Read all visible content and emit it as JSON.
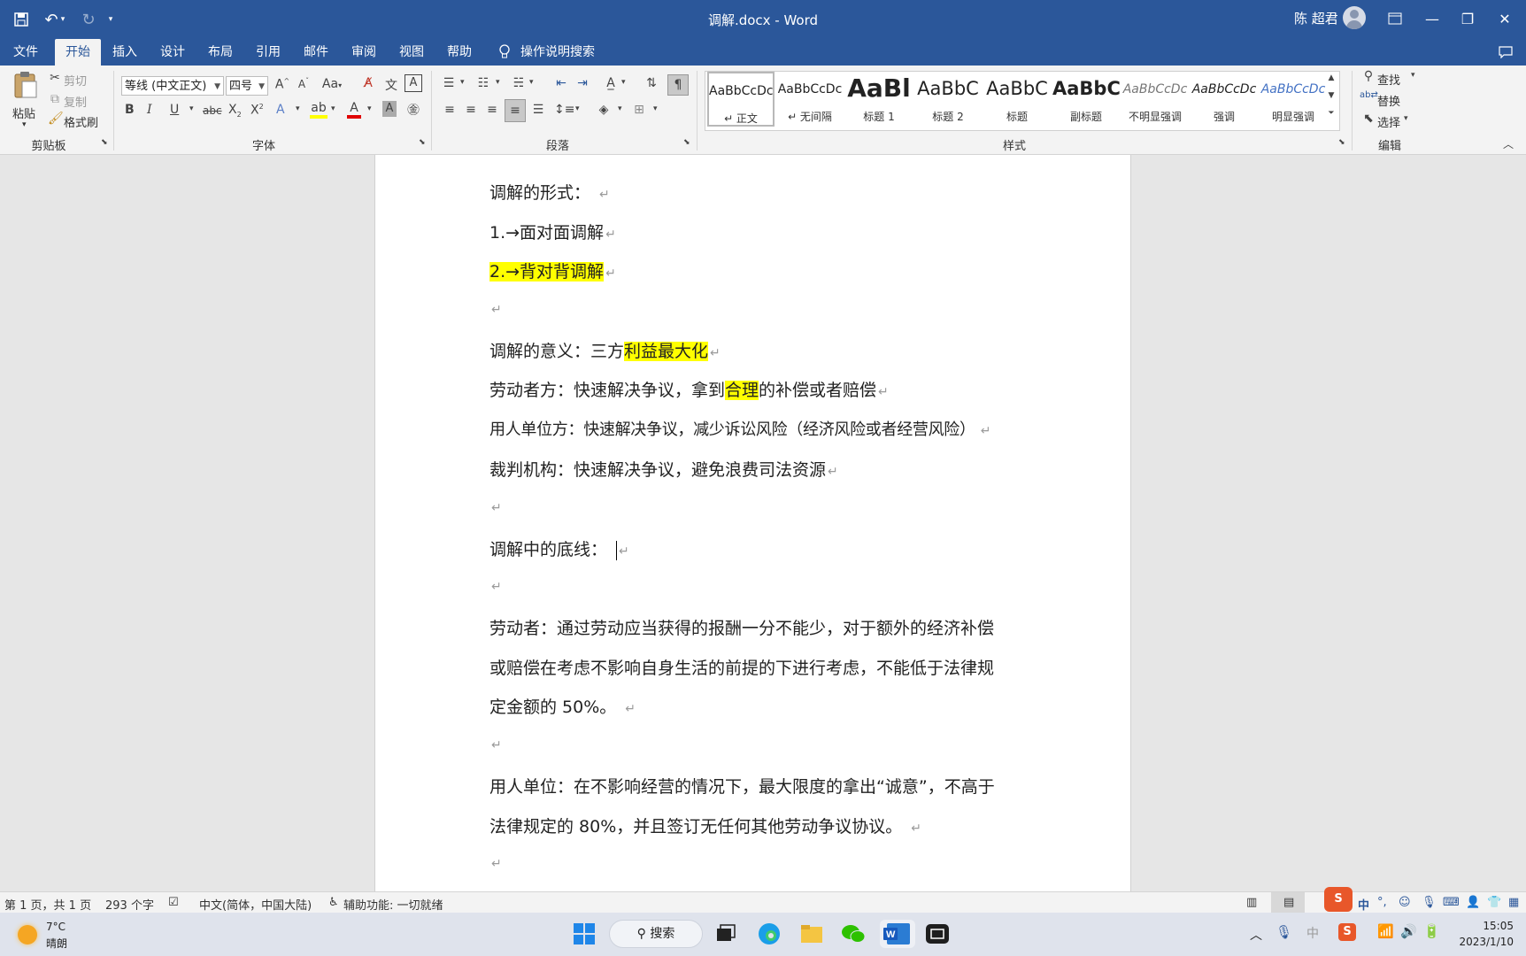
{
  "window": {
    "title": "调解.docx  -  Word",
    "user": "陈 超君"
  },
  "tabs": [
    "文件",
    "开始",
    "插入",
    "设计",
    "布局",
    "引用",
    "邮件",
    "审阅",
    "视图",
    "帮助"
  ],
  "tell_me": "操作说明搜索",
  "ribbon": {
    "clipboard": {
      "paste": "粘贴",
      "cut": "剪切",
      "copy": "复制",
      "format_painter": "格式刷",
      "label": "剪贴板"
    },
    "font": {
      "name": "等线 (中文正文)",
      "size": "四号",
      "label": "字体",
      "case": "Aa"
    },
    "paragraph": {
      "label": "段落"
    },
    "styles": {
      "label": "样式",
      "items": [
        {
          "sample": "AaBbCcDc",
          "name": "↵ 正文"
        },
        {
          "sample": "AaBbCcDc",
          "name": "↵ 无间隔"
        },
        {
          "sample": "AaBl",
          "name": "标题 1"
        },
        {
          "sample": "AaBbC",
          "name": "标题 2"
        },
        {
          "sample": "AaBbC",
          "name": "标题"
        },
        {
          "sample": "AaBbC",
          "name": "副标题"
        },
        {
          "sample": "AaBbCcDc",
          "name": "不明显强调"
        },
        {
          "sample": "AaBbCcDc",
          "name": "强调"
        },
        {
          "sample": "AaBbCcDc",
          "name": "明显强调"
        }
      ]
    },
    "editing": {
      "find": "查找",
      "replace": "替换",
      "select": "选择",
      "label": "编辑"
    }
  },
  "document": {
    "p1": "调解的形式：",
    "p2": "1.→面对面调解",
    "p3": "2.→背对背调解",
    "p5_a": "调解的意义：三方",
    "p5_b": "利益最大化",
    "p6_a": "劳动者方：快速解决争议，拿到",
    "p6_b": "合理",
    "p6_c": "的补偿或者赔偿",
    "p7": "用人单位方：快速解决争议，减少诉讼风险（经济风险或者经营风险）",
    "p8": "裁判机构：快速解决争议，避免浪费司法资源",
    "p10": "调解中的底线：",
    "p12_1": "劳动者：通过劳动应当获得的报酬一分不能少，对于额外的经济补偿",
    "p12_2": "或赔偿在考虑不影响自身生活的前提的下进行考虑，不能低于法律规",
    "p12_3": "定金额的 50%。",
    "p14_1": "用人单位：在不影响经营的情况下，最大限度的拿出“诚意”，不高于",
    "p14_2": "法律规定的 80%，并且签订无任何其他劳动争议协议。",
    "para_mark": "↵"
  },
  "status": {
    "page": "第 1 页，共 1 页",
    "words": "293 个字",
    "language": "中文(简体，中国大陆)",
    "accessibility": "辅助功能: 一切就绪"
  },
  "taskbar": {
    "weather_temp": "7°C",
    "weather_desc": "晴朗",
    "search": "搜索",
    "time": "15:05",
    "date": "2023/1/10",
    "ime": "中"
  }
}
